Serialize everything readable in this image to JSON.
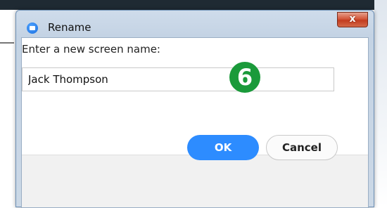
{
  "window": {
    "title": "Rename",
    "close_glyph": "x"
  },
  "dialog": {
    "prompt": "Enter a new screen name:",
    "name_value": "Jack Thompson",
    "step_badge": "6"
  },
  "buttons": {
    "ok": "OK",
    "cancel": "Cancel"
  },
  "colors": {
    "ok_button": "#2d8cff",
    "step_badge": "#1a9a3a",
    "close_button": "#c23c1f"
  },
  "icons": {
    "app": "zoom-camera-icon"
  }
}
